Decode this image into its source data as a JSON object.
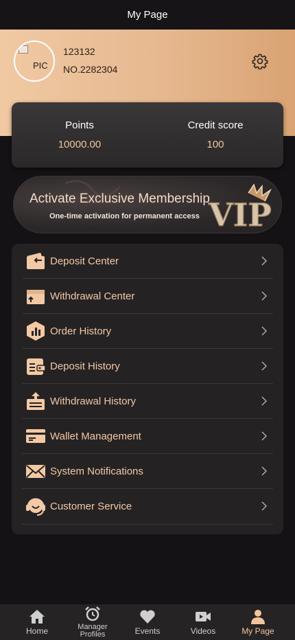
{
  "header": {
    "title": "My Page"
  },
  "profile": {
    "avatar_alt": "PIC",
    "username": "123132",
    "account_no": "NO.2282304"
  },
  "stats": {
    "points_label": "Points",
    "points_value": "10000.00",
    "credit_label": "Credit score",
    "credit_value": "100"
  },
  "banner": {
    "title": "Activate Exclusive Membership",
    "subtitle": "One-time activation for permanent access",
    "badge": "VIP"
  },
  "menu": {
    "items": [
      {
        "label": "Deposit Center",
        "icon": "wallet-in-icon"
      },
      {
        "label": "Withdrawal Center",
        "icon": "wallet-out-icon"
      },
      {
        "label": "Order History",
        "icon": "chart-hexagon-icon"
      },
      {
        "label": "Deposit History",
        "icon": "receipt-icon"
      },
      {
        "label": "Withdrawal History",
        "icon": "box-upload-icon"
      },
      {
        "label": "Wallet Management",
        "icon": "card-icon"
      },
      {
        "label": "System Notifications",
        "icon": "envelope-icon"
      },
      {
        "label": "Customer Service",
        "icon": "headset-icon"
      }
    ]
  },
  "tabbar": {
    "tabs": [
      {
        "label": "Home",
        "icon": "home-icon"
      },
      {
        "label": "Manager Profiles",
        "icon": "alarm-clock-icon"
      },
      {
        "label": "Events",
        "icon": "heart-icon"
      },
      {
        "label": "Videos",
        "icon": "video-camera-icon"
      },
      {
        "label": "My Page",
        "icon": "user-icon"
      }
    ],
    "active": "My Page"
  },
  "colors": {
    "accent": "#f3c49b",
    "menu_text": "#f2c9a4",
    "hero_start": "#f0c9a3",
    "hero_end": "#d9a373",
    "background": "#141214"
  }
}
